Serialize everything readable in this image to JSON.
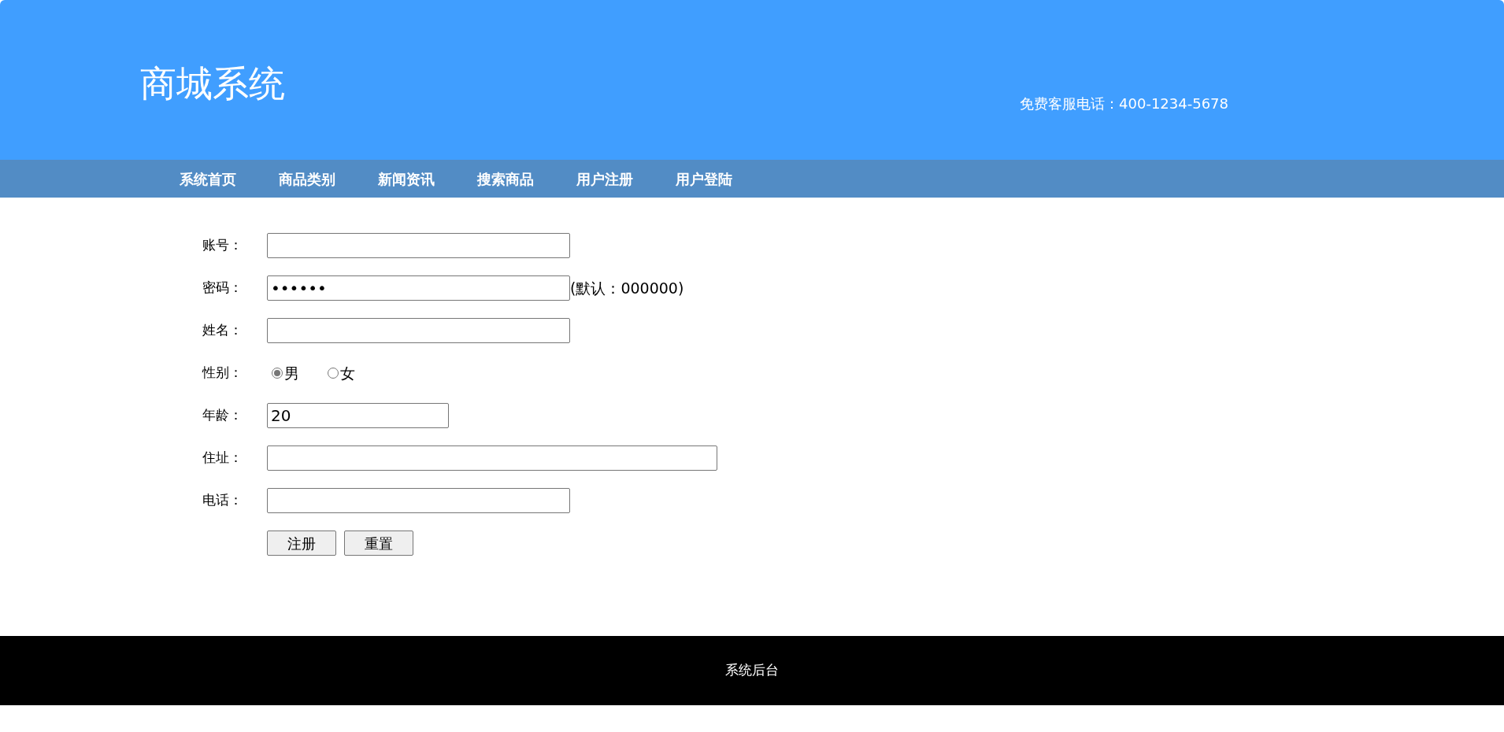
{
  "header": {
    "title": "商城系统",
    "hotline": "免费客服电话：400-1234-5678"
  },
  "nav": [
    {
      "label": "系统首页"
    },
    {
      "label": "商品类别"
    },
    {
      "label": "新闻资讯"
    },
    {
      "label": "搜索商品"
    },
    {
      "label": "用户注册"
    },
    {
      "label": "用户登陆"
    }
  ],
  "form": {
    "fields": [
      {
        "kind": "text",
        "label": "账号："
      },
      {
        "kind": "text",
        "label": "密码：",
        "value": "••••••",
        "hint": "(默认：000000)"
      },
      {
        "kind": "text",
        "label": "姓名："
      },
      {
        "kind": "radio",
        "label": "性别：",
        "options": [
          {
            "label": "男",
            "selected": true
          },
          {
            "label": "女",
            "selected": false
          }
        ]
      },
      {
        "kind": "number",
        "label": "年龄：",
        "value": "20"
      },
      {
        "kind": "address",
        "label": "住址："
      },
      {
        "kind": "text",
        "label": "电话："
      }
    ],
    "buttons": [
      "注册",
      "重置"
    ]
  },
  "footer": {
    "text": "系统后台"
  }
}
